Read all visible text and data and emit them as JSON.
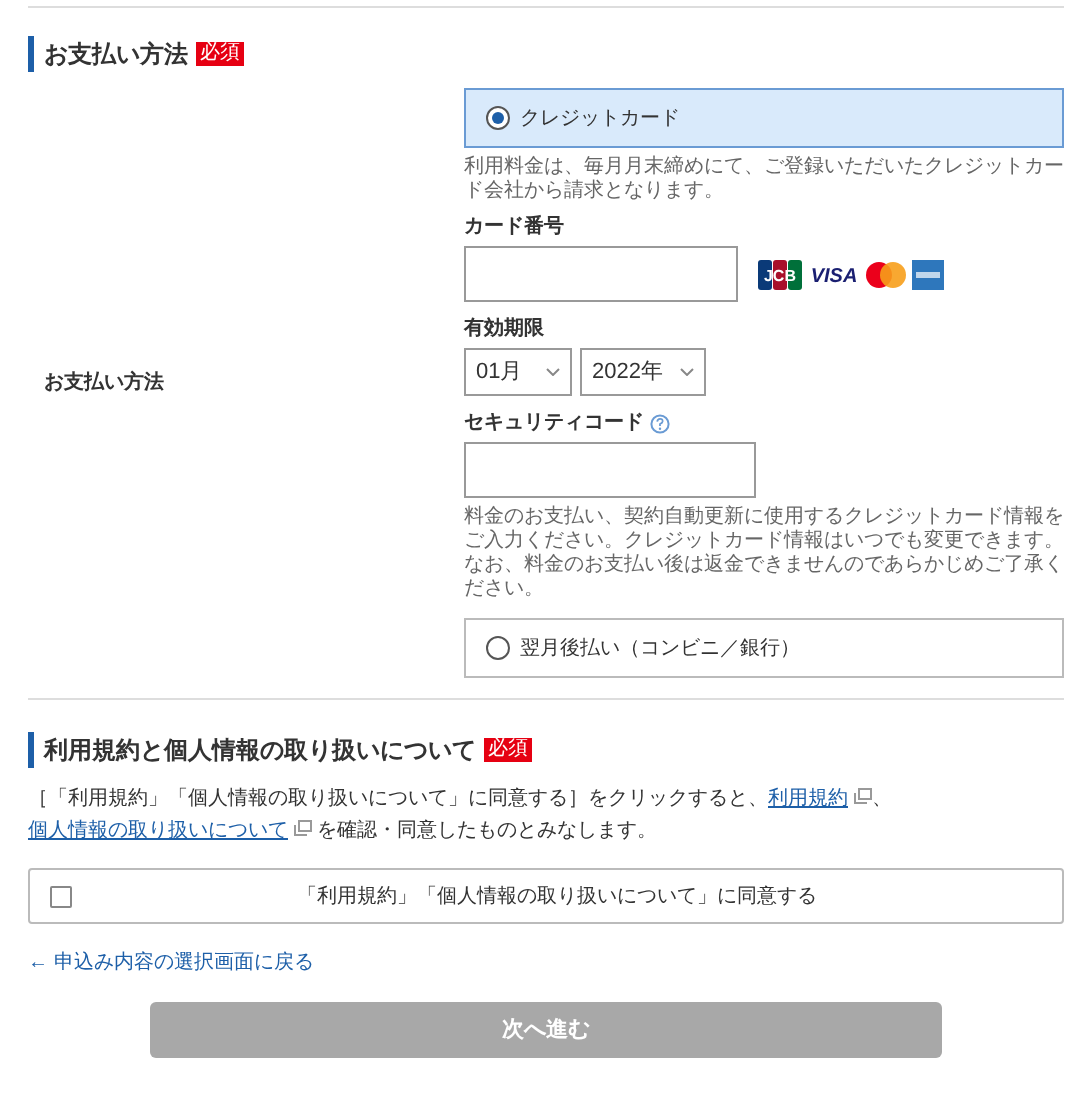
{
  "payment_section": {
    "heading": "お支払い方法",
    "required_badge": "必須",
    "row_label": "お支払い方法",
    "options": [
      {
        "label": "クレジットカード",
        "selected": true,
        "kind": "card"
      },
      {
        "label": "翌月後払い（コンビニ／銀行）",
        "selected": false,
        "kind": "plain"
      }
    ],
    "card_note": "利用料金は、毎月月末締めにて、ご登録いただいたクレジットカード会社から請求となります。",
    "card_number": {
      "label": "カード番号"
    },
    "card_brands": [
      {
        "kind": "jcb",
        "label": "JCB"
      },
      {
        "kind": "visa",
        "label": "VISA"
      },
      {
        "kind": "mastercard"
      },
      {
        "kind": "amex"
      }
    ],
    "expiry": {
      "label": "有効期限",
      "month": "01月",
      "year": "2022年"
    },
    "security_code": {
      "label": "セキュリティコード"
    },
    "security_note": "料金のお支払い、契約自動更新に使用するクレジットカード情報をご入力ください。クレジットカード情報はいつでも変更できます。なお、料金のお支払い後は返金できませんのであらかじめご了承ください。"
  },
  "terms_section": {
    "heading": "利用規約と個人情報の取り扱いについて",
    "required_badge": "必須",
    "text_before": "［「利用規約」「個人情報の取り扱いについて」に同意する］をクリックすると、",
    "link_1": "利用規約",
    "separator": "、",
    "link_2": "個人情報の取り扱いについて",
    "text_after": "を確認・同意したものとみなします。",
    "agree": {
      "label": "「利用規約」「個人情報の取り扱いについて」に同意する",
      "checked": false
    }
  },
  "back_link": "← 申込み内容の選択画面に戻る",
  "next_button": {
    "label": "次へ進む",
    "disabled": true
  }
}
